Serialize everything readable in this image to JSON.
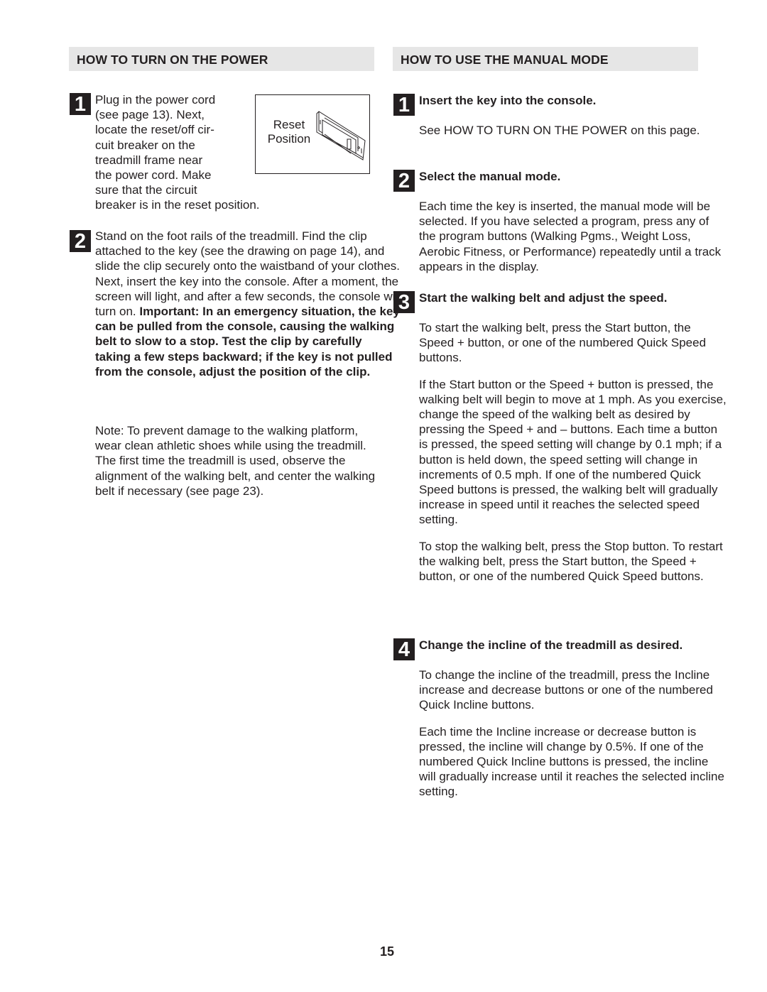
{
  "page_number": "15",
  "left": {
    "header": "HOW TO TURN ON THE POWER",
    "step1": {
      "number": "1",
      "lines": [
        "Plug in the power cord",
        "(see page 13). Next,",
        "locate the reset/off cir-",
        "cuit breaker on the",
        "treadmill frame near",
        "the power cord. Make",
        "sure that the circuit"
      ],
      "tail": "breaker is in the reset position.",
      "figure_label_line1": "Reset",
      "figure_label_line2": "Position",
      "figure_icon": "circuit-breaker-switch-illustration"
    },
    "step2": {
      "number": "2",
      "text": "Stand on the foot rails of the treadmill. Find the clip attached to the key (see the drawing on page 14), and slide the clip securely onto the waistband of your clothes. Next, insert the key into the console. After a moment, the screen will light, and after a few seconds, the console will turn on.",
      "important": "Important: In an emergency situation, the key can be pulled from the console, causing the walking belt to slow to a stop. Test the clip by carefully taking a few steps backward; if the key is not pulled from the console, adjust the position of the clip."
    },
    "note": "Note: To prevent damage to the walking platform, wear clean athletic shoes while using the treadmill. The first time the treadmill is used, observe the alignment of the walking belt, and center the walking belt if necessary (see page 23)."
  },
  "right": {
    "header": "HOW TO USE THE MANUAL MODE",
    "steps": [
      {
        "number": "1",
        "title": "Insert the key into the console.",
        "paragraphs": [
          "See HOW TO TURN ON THE POWER on this page."
        ]
      },
      {
        "number": "2",
        "title": "Select the manual mode.",
        "paragraphs": [
          "Each time the key is inserted, the manual mode will be selected. If you have selected a program, press any of the program buttons (Walking Pgms., Weight Loss, Aerobic Fitness, or Performance) repeatedly until a track appears in the display."
        ]
      },
      {
        "number": "3",
        "title": "Start the walking belt and adjust the speed.",
        "paragraphs": [
          "To start the walking belt, press the Start button, the Speed + button, or one of the numbered Quick Speed buttons.",
          "If the Start button or the Speed + button is pressed, the walking belt will begin to move at 1 mph. As you exercise, change the speed of the walking belt as desired by pressing the Speed + and – buttons. Each time a button is pressed, the speed setting will change by 0.1 mph; if a button is held down, the speed setting will change in increments of 0.5 mph. If one of the numbered Quick Speed buttons is pressed, the walking belt will gradually increase in speed until it reaches the selected speed setting.",
          "To stop the walking belt, press the Stop button. To restart the walking belt, press the Start button, the Speed + button, or one of the numbered Quick Speed buttons."
        ]
      },
      {
        "number": "4",
        "title": "Change the incline of the treadmill as desired.",
        "paragraphs": [
          "To change the incline of the treadmill, press the Incline increase and decrease buttons or one of the numbered Quick Incline buttons.",
          "Each time the Incline increase or decrease button is pressed, the incline will change by 0.5%. If one of the numbered Quick Incline buttons is pressed, the incline will gradually increase until it reaches the selected incline setting."
        ]
      }
    ]
  }
}
